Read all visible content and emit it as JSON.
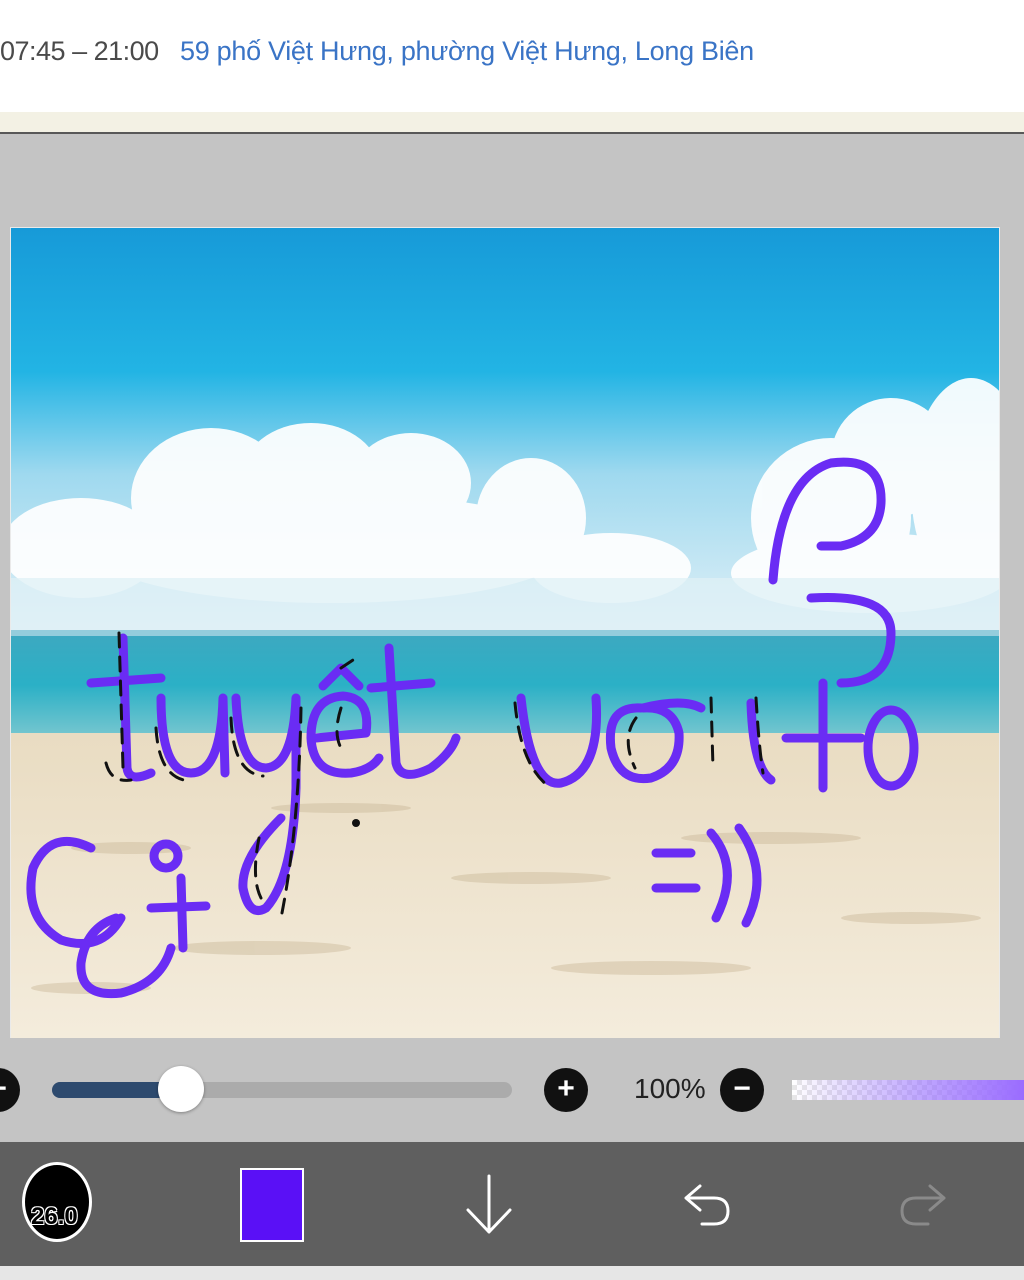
{
  "header": {
    "hours": "07:45 – 21:00",
    "address": "59 phố Việt Hưng, phường Việt Hưng, Long Biên"
  },
  "drawing": {
    "handwriting": [
      "tuyệt vời",
      "?",
      "+o",
      "ơi",
      "=))"
    ],
    "ink_color": "#6a2cf4"
  },
  "controls": {
    "brush_slider_value": 0.28,
    "zoom": "100%",
    "minus_label": "−",
    "plus_label": "+"
  },
  "toolbar": {
    "brush_size": "26.0",
    "color": "#5a10f6",
    "icons": [
      "brush-size-icon",
      "color-swatch",
      "download-arrow-icon",
      "undo-icon",
      "redo-icon"
    ]
  }
}
